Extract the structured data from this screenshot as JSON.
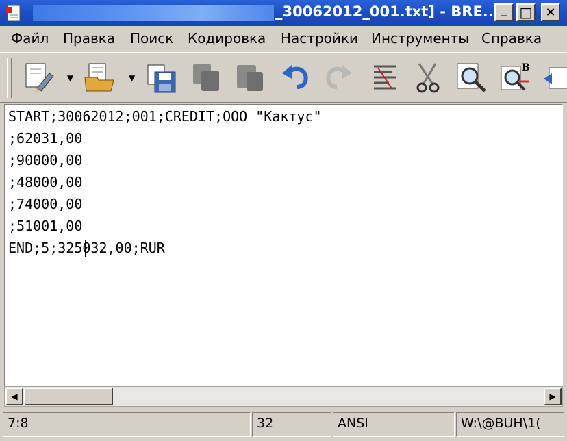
{
  "window": {
    "title": "_30062012_001.txt] - BRE...",
    "minimize_glyph": "_",
    "maximize_glyph": "□",
    "close_glyph": "✕"
  },
  "menu": [
    "Файл",
    "Правка",
    "Поиск",
    "Кодировка",
    "Настройки",
    "Инструменты",
    "Справка"
  ],
  "toolbar": {
    "tools": [
      "new-file",
      "open-file",
      "save",
      "copy",
      "paste",
      "undo",
      "redo",
      "format",
      "cut",
      "find",
      "find-replace",
      "more"
    ]
  },
  "editor": {
    "lines": [
      "START;30062012;001;CREDIT;ООО \"Кактус\"",
      ";62031,00",
      ";90000,00",
      ";48000,00",
      ";74000,00",
      ";51001,00",
      "END;5;325032,00;RUR"
    ]
  },
  "status": {
    "position": "7:8",
    "column": "32",
    "encoding": "ANSI",
    "path": "W:\\@BUH\\1("
  }
}
